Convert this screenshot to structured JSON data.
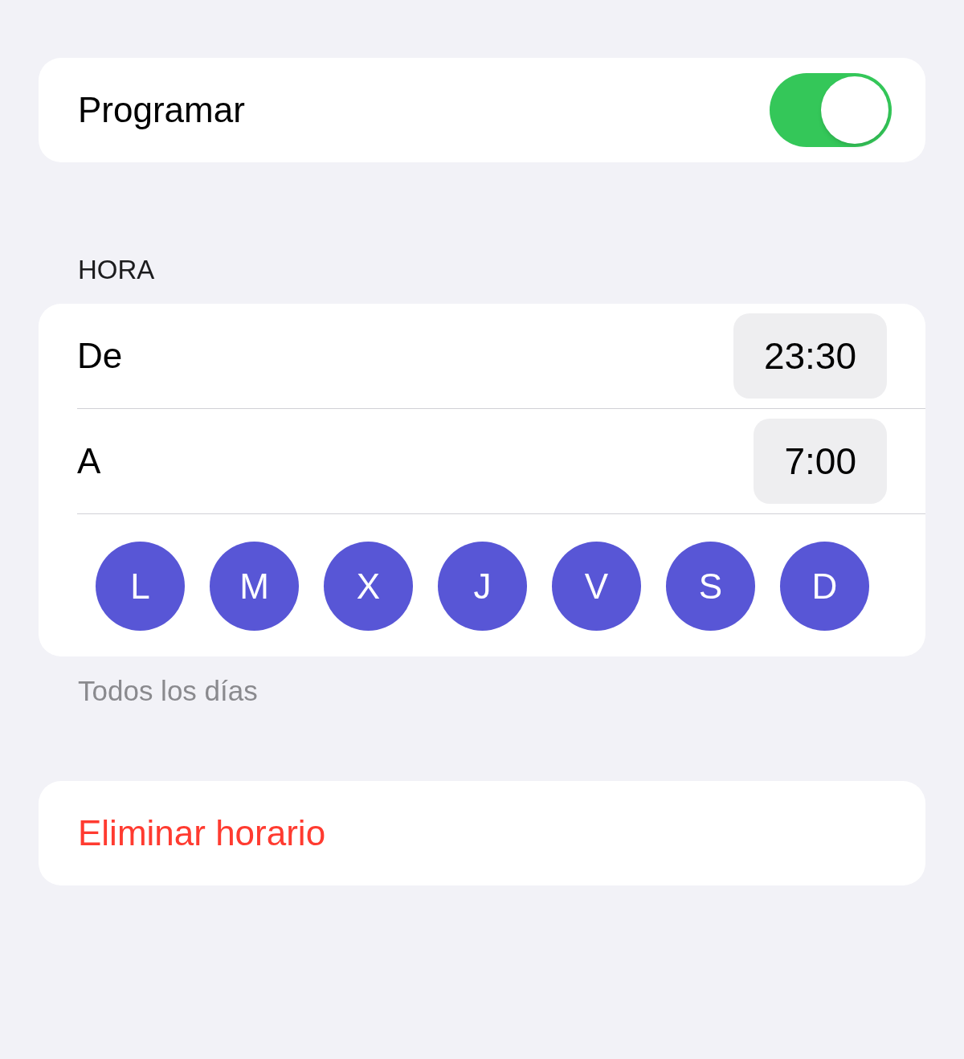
{
  "schedule": {
    "label": "Programar",
    "on": true
  },
  "time_section": {
    "header": "HORA",
    "rows": [
      {
        "label": "De",
        "value": "23:30"
      },
      {
        "label": "A",
        "value": "7:00"
      }
    ],
    "days": [
      {
        "label": "L",
        "selected": true
      },
      {
        "label": "M",
        "selected": true
      },
      {
        "label": "X",
        "selected": true
      },
      {
        "label": "J",
        "selected": true
      },
      {
        "label": "V",
        "selected": true
      },
      {
        "label": "S",
        "selected": true
      },
      {
        "label": "D",
        "selected": true
      }
    ],
    "footer": "Todos los días"
  },
  "delete_button": {
    "label": "Eliminar horario"
  }
}
